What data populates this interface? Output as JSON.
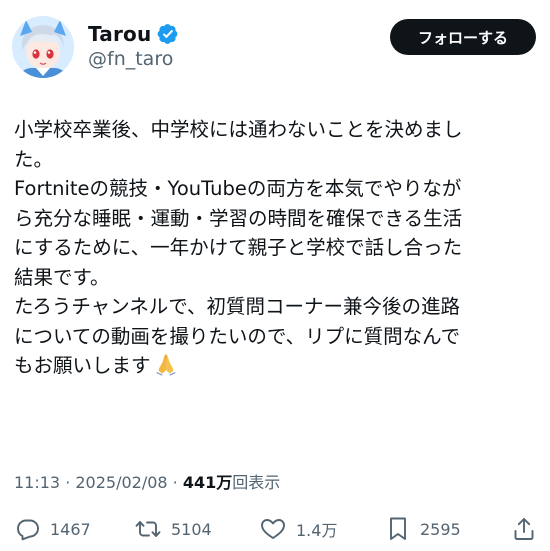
{
  "author": {
    "display_name": "Tarou",
    "handle": "@fn_taro",
    "verified": true,
    "follow_label": "フォローする"
  },
  "tweet": {
    "lines": [
      "小学校卒業後、中学校には通わないことを決めまし",
      "た。",
      "Fortniteの競技・YouTubeの両方を本気でやりなが",
      "ら充分な睡眠・運動・学習の時間を確保できる生活",
      "にするために、一年かけて親子と学校で話し合った",
      "結果です。",
      "たろうチャンネルで、初質問コーナー兼今後の進路",
      "についての動画を撮りたいので、リプに質問なんで",
      "もお願いします"
    ],
    "emoji": "folded-hands"
  },
  "meta": {
    "time": "11:13",
    "separator": " · ",
    "date": "2025/02/08",
    "views_count": "441万",
    "views_label": "回表示"
  },
  "actions": {
    "replies": "1467",
    "reposts": "5104",
    "likes": "1.4万",
    "bookmarks": "2595"
  },
  "colors": {
    "text_primary": "#0f1419",
    "text_secondary": "#536471",
    "verified_blue": "#1d9bf0",
    "follow_button_bg": "#0f1419"
  }
}
